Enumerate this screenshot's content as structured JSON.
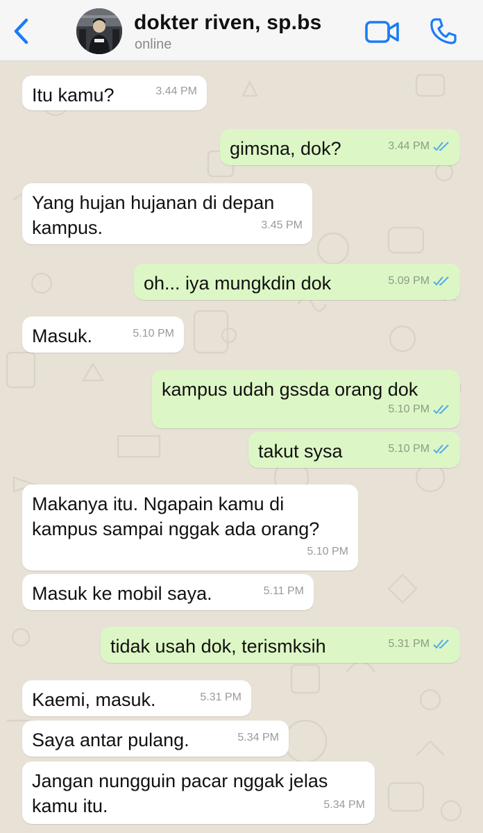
{
  "header": {
    "contact_name": "dokter riven, sp.bs",
    "status": "online",
    "back_icon": "chevron-left-icon",
    "video_icon": "video-camera-icon",
    "call_icon": "phone-icon",
    "accent_color": "#1a7cf5"
  },
  "colors": {
    "incoming_bubble": "#ffffff",
    "outgoing_bubble": "#dcf7c5",
    "read_ticks": "#4fa9e8",
    "wallpaper": "#e7e1d6"
  },
  "messages": [
    {
      "dir": "in",
      "text": "Itu kamu?",
      "time": "3.44 PM"
    },
    {
      "dir": "out",
      "text": "gimsna, dok?",
      "time": "3.44 PM",
      "ticks": "read"
    },
    {
      "dir": "in",
      "text": "Yang hujan hujanan di depan\nkampus.",
      "time": "3.45 PM"
    },
    {
      "dir": "out",
      "text": "oh... iya mungkdin dok",
      "time": "5.09 PM",
      "ticks": "read"
    },
    {
      "dir": "in",
      "text": "Masuk.",
      "time": "5.10 PM"
    },
    {
      "dir": "out",
      "text": "kampus udah gssda orang dok",
      "time": "5.10 PM",
      "ticks": "read"
    },
    {
      "dir": "out",
      "text": "takut sysa",
      "time": "5.10 PM",
      "ticks": "read"
    },
    {
      "dir": "in",
      "text": "Makanya itu. Ngapain kamu di\nkampus sampai nggak ada orang?",
      "time": "5.10 PM"
    },
    {
      "dir": "in",
      "text": "Masuk ke mobil saya.",
      "time": "5.11 PM"
    },
    {
      "dir": "out",
      "text": "tidak usah dok, terismksih",
      "time": "5.31 PM",
      "ticks": "read"
    },
    {
      "dir": "in",
      "text": "Kaemi, masuk.",
      "time": "5.31 PM"
    },
    {
      "dir": "in",
      "text": "Saya antar pulang.",
      "time": "5.34 PM"
    },
    {
      "dir": "in",
      "text": "Jangan nungguin pacar nggak jelas\nkamu itu.",
      "time": "5.34 PM"
    }
  ]
}
